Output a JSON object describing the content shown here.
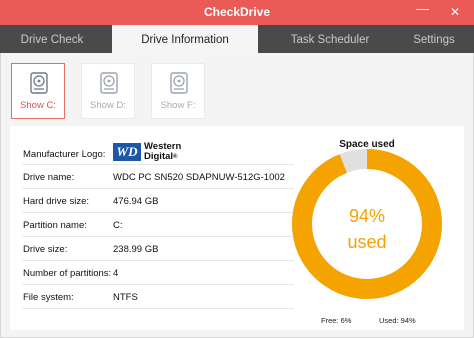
{
  "window": {
    "title": "CheckDrive",
    "minimize_glyph": "—",
    "close_glyph": "✕"
  },
  "tabs": [
    {
      "label": "Drive Check",
      "active": false
    },
    {
      "label": "Drive Information",
      "active": true
    },
    {
      "label": "Task Scheduler",
      "active": false
    },
    {
      "label": "Settings",
      "active": false
    }
  ],
  "drives": [
    {
      "label": "Show C:",
      "active": true
    },
    {
      "label": "Show D:",
      "active": false
    },
    {
      "label": "Show F:",
      "active": false
    }
  ],
  "info": {
    "rows": [
      {
        "key": "Manufacturer Logo:",
        "value": ""
      },
      {
        "key": "Drive name:",
        "value": "WDC PC SN520 SDAPNUW-512G-1002"
      },
      {
        "key": "Hard drive size:",
        "value": "476.94 GB"
      },
      {
        "key": "Partition name:",
        "value": "C:"
      },
      {
        "key": "Drive size:",
        "value": "238.99 GB"
      },
      {
        "key": "Number of partitions:",
        "value": "4"
      },
      {
        "key": "File system:",
        "value": "NTFS"
      }
    ],
    "logo": {
      "mark": "WD",
      "line1": "Western",
      "line2": "Digital",
      "trademark": "®"
    }
  },
  "space": {
    "title": "Space used",
    "percent_text": "94%",
    "used_text": "used",
    "used_fraction": 0.94,
    "free_label": "Free: 6%",
    "used_label": "Used: 94%",
    "colors": {
      "used": "#f5a300",
      "free": "#e0e0e0"
    }
  },
  "colors": {
    "titlebar": "#ea5b57",
    "tabbar": "#4a4a4a",
    "accent": "#d9534f"
  }
}
